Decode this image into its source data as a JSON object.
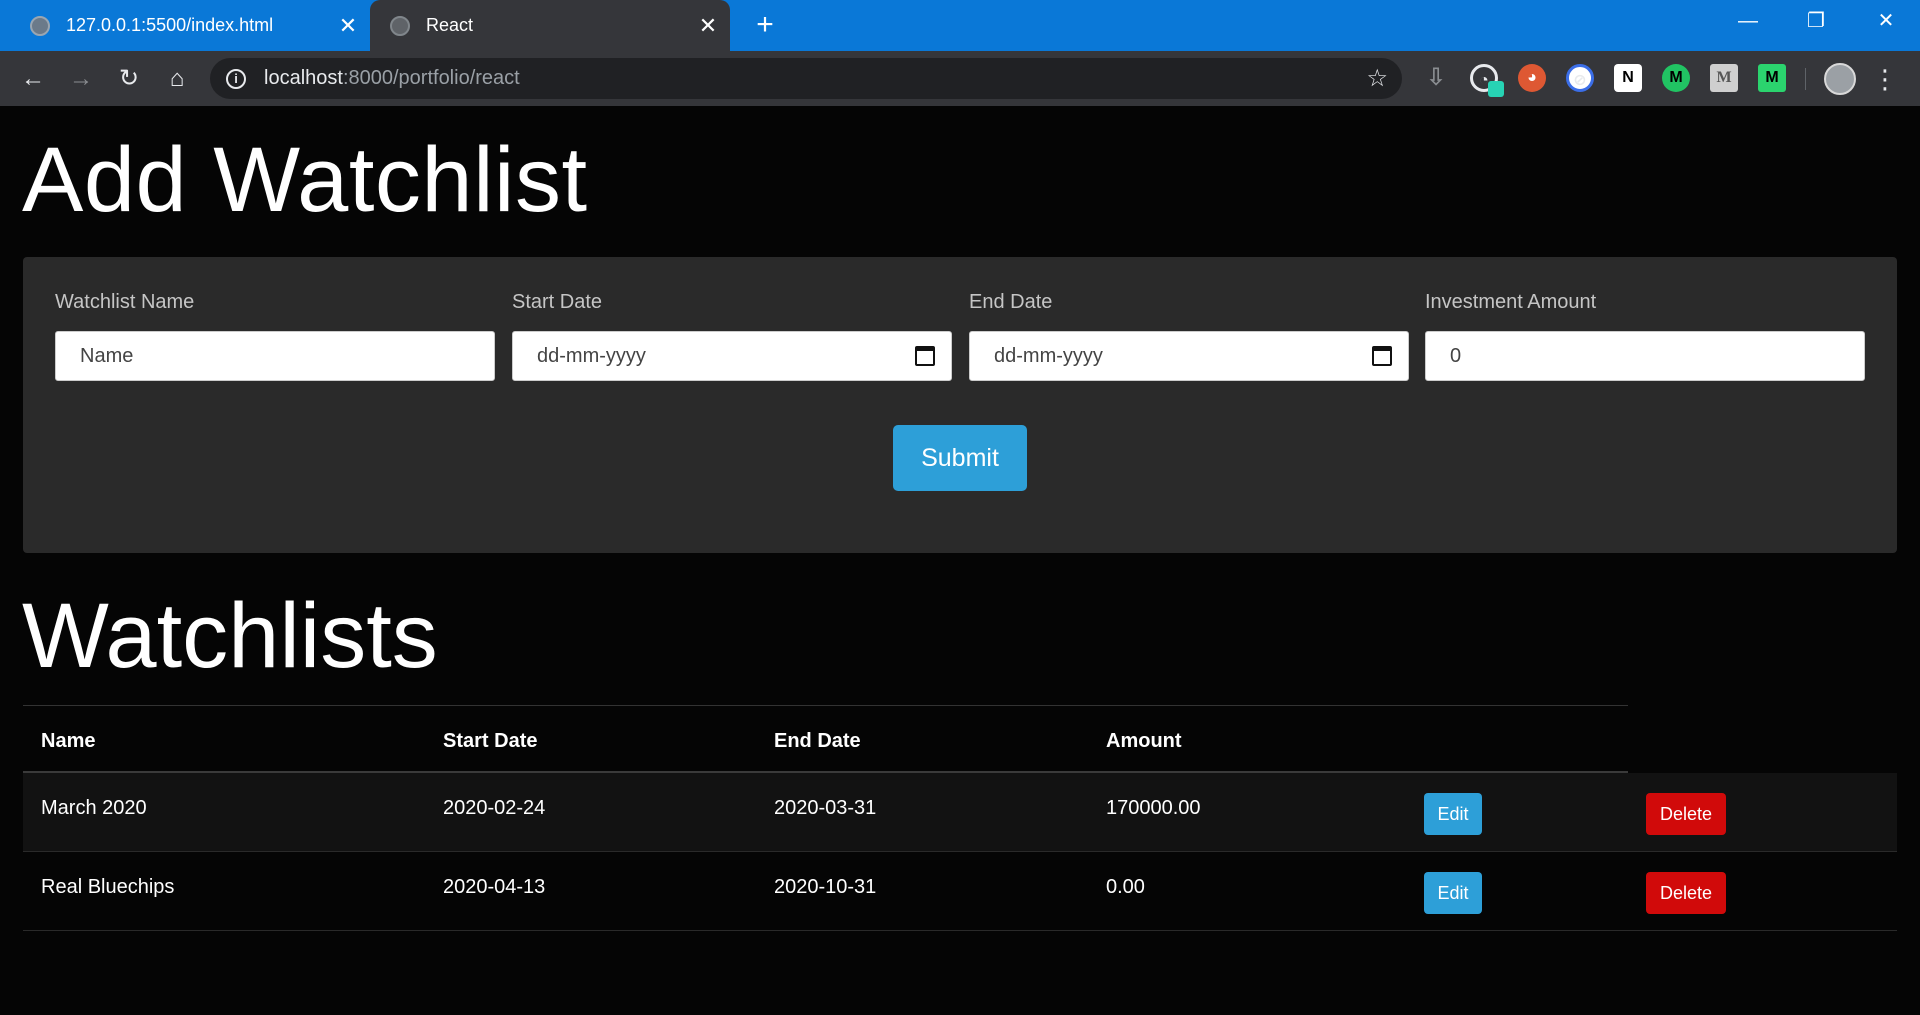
{
  "browser": {
    "tabs": [
      {
        "title": "127.0.0.1:5500/index.html",
        "close": "✕"
      },
      {
        "title": "React",
        "close": "✕"
      }
    ],
    "new_tab": "+",
    "window_controls": {
      "minimize": "—",
      "maximize": "❐",
      "close": "✕"
    },
    "nav": {
      "back": "←",
      "forward": "→",
      "reload": "↻",
      "home": "⌂"
    },
    "url": {
      "host": "localhost",
      "rest": ":8000/portfolio/react"
    },
    "star": "☆",
    "menu": "⋮",
    "extensions": {
      "download": "⇩",
      "meter": "◔",
      "duck": "◕",
      "block": "⊘",
      "notion": "N",
      "m_green": "M",
      "m_grey": "M",
      "m_fill": "M"
    },
    "accent_color": "#0a78d7"
  },
  "page": {
    "add_heading": "Add Watchlist",
    "form": {
      "name_label": "Watchlist Name",
      "name_placeholder": "Name",
      "start_label": "Start Date",
      "start_placeholder": "dd-mm-yyyy",
      "end_label": "End Date",
      "end_placeholder": "dd-mm-yyyy",
      "amount_label": "Investment Amount",
      "amount_value": "0",
      "submit_label": "Submit"
    },
    "list_heading": "Watchlists",
    "table": {
      "headers": [
        "Name",
        "Start Date",
        "End Date",
        "Amount"
      ],
      "rows": [
        {
          "name": "March 2020",
          "start": "2020-02-24",
          "end": "2020-03-31",
          "amount": "170000.00",
          "edit": "Edit",
          "delete": "Delete"
        },
        {
          "name": "Real Bluechips",
          "start": "2020-04-13",
          "end": "2020-10-31",
          "amount": "0.00",
          "edit": "Edit",
          "delete": "Delete"
        }
      ]
    },
    "colors": {
      "primary": "#2d9fd8",
      "danger": "#d10a0a",
      "background": "#050505",
      "card": "#2a2a2a"
    }
  }
}
